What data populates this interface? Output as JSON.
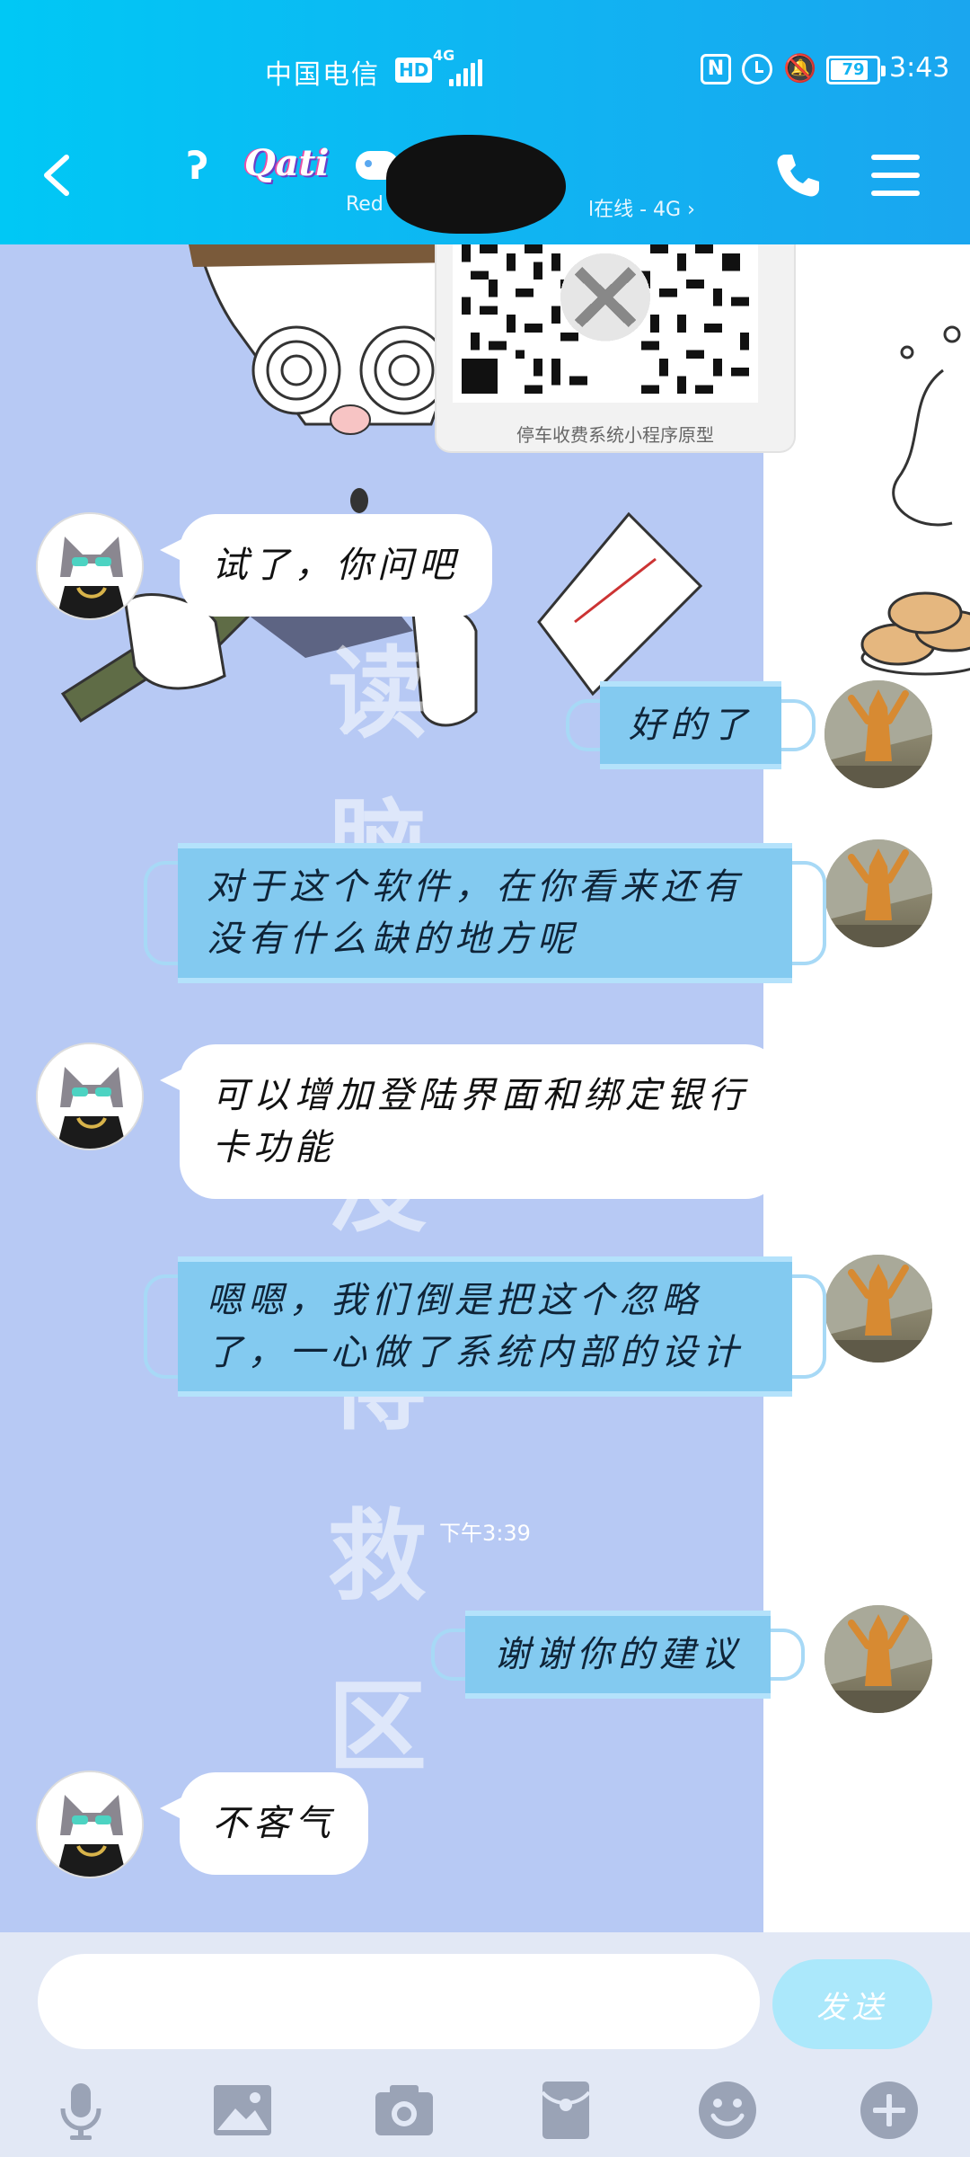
{
  "status_bar": {
    "carrier": "中国电信",
    "hd": "HD",
    "network": "4G",
    "battery": "79",
    "time": "3:43"
  },
  "header": {
    "logo_text": "Qati",
    "subtitle": "Red",
    "subtitle_tail": "l在线 - 4G ›"
  },
  "shared_card": {
    "caption": "停车收费系统小程序原型"
  },
  "background_words": [
    "读",
    "脑",
    "没",
    "得",
    "救",
    "区"
  ],
  "messages": [
    {
      "side": "left",
      "text": "试了，你问吧"
    },
    {
      "side": "right",
      "text": "好的了"
    },
    {
      "side": "right",
      "text": "对于这个软件，在你看来还有没有什么缺的地方呢"
    },
    {
      "side": "left",
      "text": "可以增加登陆界面和绑定银行卡功能"
    },
    {
      "side": "right",
      "text": "嗯嗯，我们倒是把这个忽略了，一心做了系统内部的设计"
    },
    {
      "side": "right",
      "text": "谢谢你的建议"
    },
    {
      "side": "left",
      "text": "不客气"
    }
  ],
  "timestamp": "下午3:39",
  "input": {
    "placeholder": "",
    "send_label": "发送"
  },
  "toolbar": {
    "icons": [
      "microphone-icon",
      "image-icon",
      "camera-icon",
      "red-packet-icon",
      "emoji-icon",
      "plus-icon"
    ]
  },
  "colors": {
    "header": "#10b4f2",
    "chat_bg": "#b7c9f4",
    "right_bubble": "#83caf0",
    "send_button": "#abe8fb",
    "input_area": "#e2e8f5"
  }
}
